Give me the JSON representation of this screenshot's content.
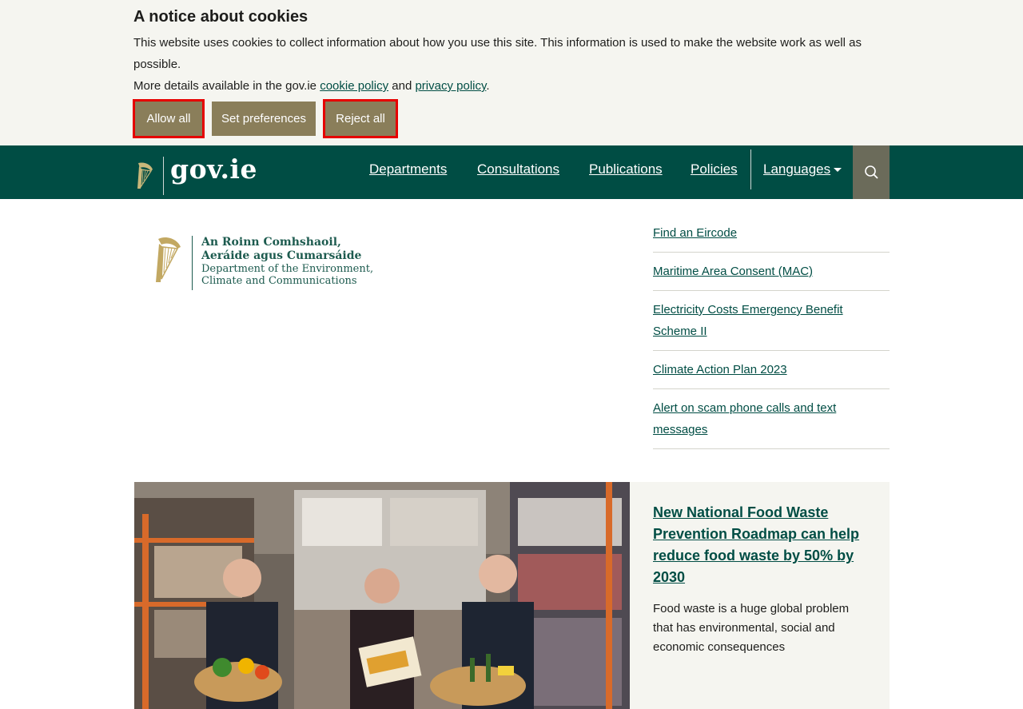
{
  "cookie_banner": {
    "title": "A notice about cookies",
    "text": "This website uses cookies to collect information about how you use this site. This information is used to make the website work as well as possible.",
    "more_prefix": "More details available in the gov.ie ",
    "cookie_policy_link": "cookie policy",
    "and_text": " and ",
    "privacy_policy_link": "privacy policy",
    "more_suffix": ".",
    "buttons": {
      "allow_all": "Allow all",
      "set_preferences": "Set preferences",
      "reject_all": "Reject all"
    }
  },
  "header": {
    "logo_text": "gov.ie",
    "nav": [
      {
        "label": "Departments"
      },
      {
        "label": "Consultations"
      },
      {
        "label": "Publications"
      },
      {
        "label": "Policies"
      }
    ],
    "languages_label": "Languages"
  },
  "department": {
    "line1": "An Roinn Comhshaoil,",
    "line2": "Aeráide agus Cumarsáide",
    "line3": "Department of the Environment,",
    "line4": "Climate and Communications"
  },
  "quick_links": [
    {
      "label": "Find an Eircode"
    },
    {
      "label": "Maritime Area Consent (MAC)"
    },
    {
      "label": "Electricity Costs Emergency Benefit Scheme II"
    },
    {
      "label": "Climate Action Plan 2023"
    },
    {
      "label": "Alert on scam phone calls and text messages"
    }
  ],
  "feature": {
    "title": "New National Food Waste Prevention Roadmap can help reduce food waste by 50% by 2030",
    "description": "Food waste is a huge global problem that has environmental, social and economic consequences"
  },
  "colors": {
    "header_bg": "#004d44",
    "cookie_button": "#8a7e5a",
    "highlight_outline": "#e60000",
    "link": "#004d44"
  }
}
